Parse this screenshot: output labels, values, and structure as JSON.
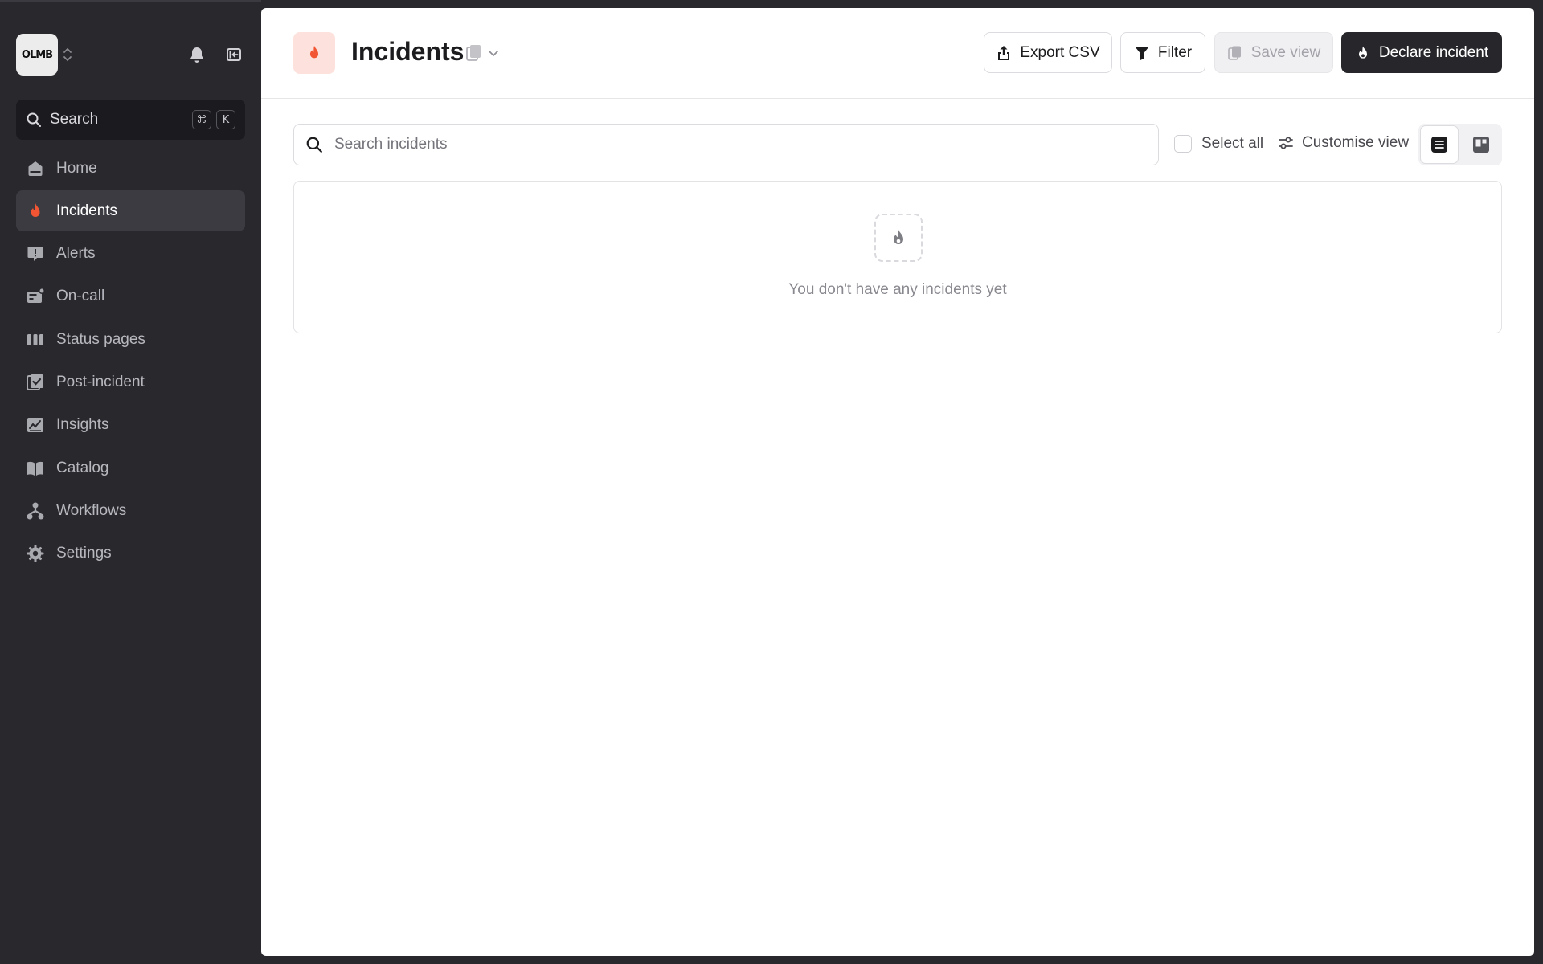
{
  "sidebar": {
    "org_logo_text": "OLMB",
    "search": {
      "label": "Search",
      "shortcut_keys": [
        "⌘",
        "K"
      ]
    },
    "items": [
      {
        "label": "Home",
        "icon": "home-icon",
        "active": false
      },
      {
        "label": "Incidents",
        "icon": "flame-icon",
        "active": true
      },
      {
        "label": "Alerts",
        "icon": "alert-icon",
        "active": false
      },
      {
        "label": "On-call",
        "icon": "pager-icon",
        "active": false
      },
      {
        "label": "Status pages",
        "icon": "status-bars-icon",
        "active": false
      },
      {
        "label": "Post-incident",
        "icon": "checklist-icon",
        "active": false
      },
      {
        "label": "Insights",
        "icon": "chart-icon",
        "active": false
      },
      {
        "label": "Catalog",
        "icon": "book-icon",
        "active": false
      },
      {
        "label": "Workflows",
        "icon": "workflow-icon",
        "active": false
      },
      {
        "label": "Settings",
        "icon": "gear-icon",
        "active": false
      }
    ]
  },
  "header": {
    "title": "Incidents",
    "buttons": {
      "export": "Export CSV",
      "filter": "Filter",
      "save_view": "Save view",
      "declare": "Declare incident"
    }
  },
  "toolbar": {
    "search_placeholder": "Search incidents",
    "select_all": "Select all",
    "customise": "Customise view"
  },
  "empty_state": {
    "message": "You don't have any incidents yet"
  },
  "colors": {
    "sidebar_bg": "#28282d",
    "accent_flame": "#f25533",
    "primary_button": "#27272b"
  }
}
